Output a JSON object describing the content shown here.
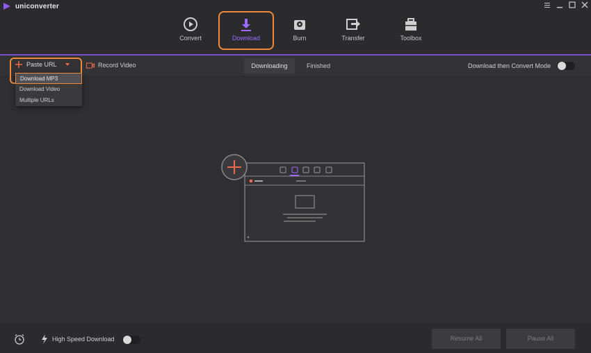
{
  "app": {
    "name": "uniconverter"
  },
  "tabs": [
    {
      "label": "Convert",
      "icon": "convert-icon"
    },
    {
      "label": "Download",
      "icon": "download-icon",
      "active": true
    },
    {
      "label": "Burn",
      "icon": "burn-icon"
    },
    {
      "label": "Transfer",
      "icon": "transfer-icon"
    },
    {
      "label": "Toolbox",
      "icon": "toolbox-icon"
    }
  ],
  "toolbar": {
    "paste_url": "Paste URL",
    "record_video": "Record Video",
    "segments": [
      "Downloading",
      "Finished"
    ],
    "mode_label": "Download then Convert Mode",
    "mode_enabled": false
  },
  "dropdown": {
    "items": [
      "Download MP3",
      "Download Video",
      "Multiple URLs"
    ],
    "highlighted": "Download MP3"
  },
  "footer": {
    "high_speed_label": "High Speed Download",
    "high_speed_enabled": false,
    "resume_all": "Resume All",
    "pause_all": "Pause All"
  },
  "colors": {
    "accent": "#9c6bff",
    "highlight_outline": "#ef8a3a",
    "plus_red": "#ef6a4a",
    "background": "#2f2f31"
  }
}
